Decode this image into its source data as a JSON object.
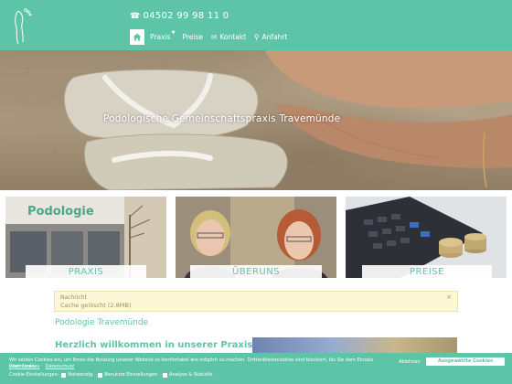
{
  "header": {
    "phone": "04502 99 98 11 0",
    "nav": [
      {
        "label": "Praxis"
      },
      {
        "label": "Preise"
      },
      {
        "label": "Kontakt"
      },
      {
        "label": "Anfahrt"
      }
    ]
  },
  "hero": {
    "title": "Podologische Gemeinschaftspraxis Travemünde"
  },
  "cards": [
    {
      "label": "PRAXIS",
      "sign_text": "Podologie"
    },
    {
      "label": "ÜBERUNS"
    },
    {
      "label": "PREISE"
    }
  ],
  "notice": {
    "title": "Nachricht",
    "text": "Cache gelöscht (2.8MB)"
  },
  "main": {
    "section_title": "Podologie Travemünde",
    "welcome": "Herzlich willkommen in unserer Praxis"
  },
  "cookie": {
    "text": "Wir setzen Cookies ein, um Ihnen die Nutzung unserer Website so komfortabel wie möglich zu machen. Drittanbietercookies sind blockiert, bis Sie dem Einsatz zustimmen.",
    "link_cookies": "Über Cookies",
    "link_privacy": "Datenschutz",
    "settings_label": "Cookie-Einstellungen:",
    "options": [
      "Notwendig",
      "Benutzte Einstellungen",
      "Analyse & Statistik"
    ],
    "decline": "Ablehnen",
    "accept": "Ausgewählte Cookies zulassen"
  },
  "colors": {
    "brand": "#5ec4a8",
    "notice_bg": "#fdf7d8",
    "notice_text": "#a38b55"
  }
}
